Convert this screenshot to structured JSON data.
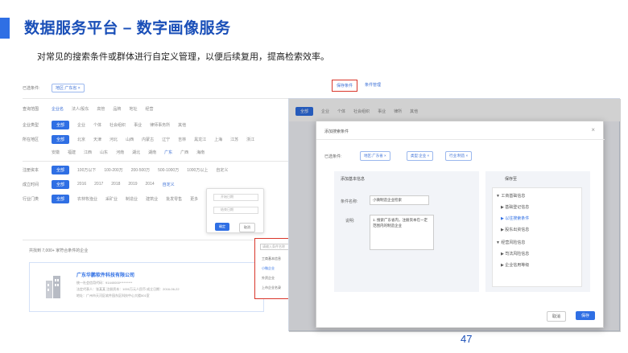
{
  "slide": {
    "title": "数据服务平台 – 数字画像服务",
    "subtitle": "对常见的搜索条件或群体进行自定义管理，以便后续复用，提高检索效率。",
    "page_number": "47"
  },
  "accent_color": "#2f6fe4",
  "highlight_color": "#d9362b",
  "left_screen": {
    "selected_label": "已选条件:",
    "selected_tag": "地区:广东省 ×",
    "save_button": "保存条件",
    "manage_link": "条件管理",
    "row_labels": [
      "查询范围",
      "企业类型",
      "所在地区",
      "",
      "注册资本",
      "成立时间",
      "行业门类"
    ],
    "all_button": "全部",
    "row1_chips": [
      "企业名",
      "法人/股东",
      "高管",
      "品牌",
      "地址",
      "经营"
    ],
    "row2_chips": [
      "企业",
      "个体",
      "社会组织",
      "事业",
      "律师事务所",
      "其他"
    ],
    "row3_chips": [
      "北京",
      "天津",
      "河北",
      "山西",
      "内蒙古",
      "辽宁",
      "吉林",
      "黑龙江",
      "上海",
      "江苏",
      "浙江"
    ],
    "row4_chips": [
      "安徽",
      "福建",
      "江西",
      "山东",
      "河南",
      "湖北",
      "湖南",
      "广东",
      "广西",
      "海南"
    ],
    "row5_chips": [
      "100万以下",
      "100-200万",
      "200-500万",
      "500-1000万",
      "1000万以上",
      "自定义"
    ],
    "row6_chips": [
      "2016",
      "2017",
      "2018",
      "2019",
      "2014",
      "自定义"
    ],
    "row7_chips": [
      "农林牧渔业",
      "采矿业",
      "制造业",
      "建筑业",
      "批发零售",
      "更多"
    ],
    "popover": {
      "from": "开始日期",
      "to": "结束日期",
      "ok": "确定",
      "cancel": "取消"
    },
    "result_count": "共找到 7,000+ 家符合条件的企业",
    "company_name": "广东华鹏软件科技有限公司",
    "company_lines": [
      "统一社会信用代码：91440000**********",
      "法定代表人：张某某    注册资本：1000万元人民币    成立日期：2016-06-22",
      "地址：广州市天河区软件园东区科技中心大楼501室"
    ],
    "dropdown": {
      "placeholder": "请输入条件名称",
      "items": [
        "工商基本信息",
        "小微企业",
        "外资企业",
        "上市企业名录"
      ]
    }
  },
  "right_screen": {
    "top_chips": [
      "全部",
      "企业",
      "个体",
      "社会组织",
      "事业",
      "律所",
      "其他"
    ],
    "modal": {
      "title": "添加搜索条件",
      "selected_label": "已选条件:",
      "tags": [
        "地区:广东省 ×",
        "类型:企业 ×",
        "行业:制造 ×"
      ],
      "left_panel_title": "添加基本信息",
      "name_label": "条件名称:",
      "name_value": "小微制造企业检索",
      "desc_label": "说明:",
      "desc_value": "1. 搜索广东省内，注册资本在一定范围内的制造企业",
      "right_panel_title": "保存至",
      "tree": [
        "工商基础信息",
        "基础登记信息",
        "以往搜索条件",
        "股东出资信息",
        "经营风险信息",
        "司法风险信息",
        "企业信用等级"
      ],
      "cancel_button": "取消",
      "save_button": "保存"
    }
  }
}
